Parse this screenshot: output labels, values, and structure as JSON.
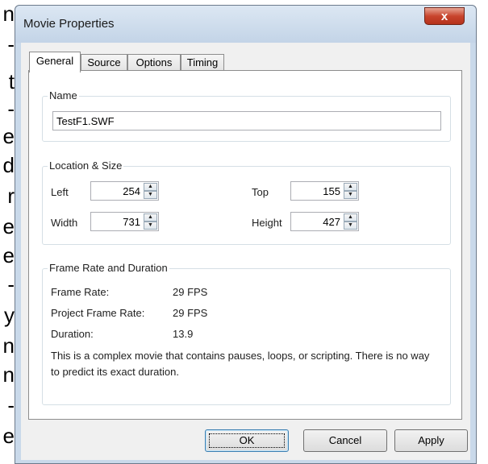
{
  "background_text": [
    "n",
    "-",
    "t",
    "-",
    "e",
    "d",
    "r",
    "e",
    "e",
    "-",
    "y",
    "n",
    "n",
    "-",
    "e"
  ],
  "window": {
    "title": "Movie Properties",
    "close_glyph": "x"
  },
  "tabs": [
    {
      "label": "General",
      "active": true
    },
    {
      "label": "Source",
      "active": false
    },
    {
      "label": "Options",
      "active": false
    },
    {
      "label": "Timing",
      "active": false
    }
  ],
  "name_group": {
    "title": "Name",
    "value": "TestF1.SWF"
  },
  "location_group": {
    "title": "Location & Size",
    "left_label": "Left",
    "left_value": "254",
    "top_label": "Top",
    "top_value": "155",
    "width_label": "Width",
    "width_value": "731",
    "height_label": "Height",
    "height_value": "427"
  },
  "frame_group": {
    "title": "Frame Rate and Duration",
    "rows": [
      {
        "label": "Frame Rate:",
        "value": "29 FPS"
      },
      {
        "label": "Project Frame Rate:",
        "value": "29 FPS"
      },
      {
        "label": "Duration:",
        "value": "13.9"
      }
    ],
    "note": "This is a complex movie that contains pauses, loops, or scripting. There is no way to predict its exact duration."
  },
  "buttons": {
    "ok": "OK",
    "cancel": "Cancel",
    "apply": "Apply"
  }
}
